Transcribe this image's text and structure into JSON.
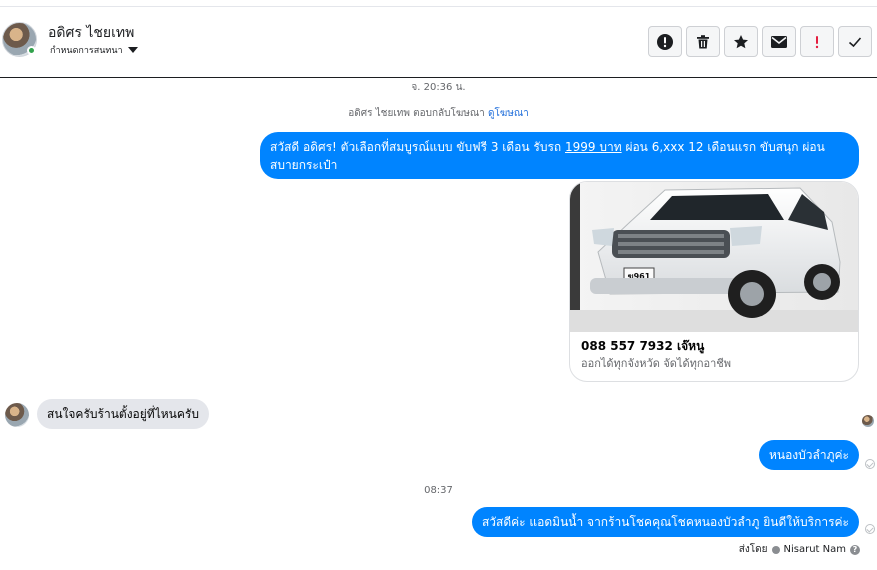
{
  "contact": {
    "name": "อดิศร ไชยเทพ",
    "assign_label": "กำหนดการสนทนา"
  },
  "toolbar": {
    "actions": [
      {
        "name": "spam-report-icon"
      },
      {
        "name": "trash-icon"
      },
      {
        "name": "star-icon"
      },
      {
        "name": "mail-icon"
      },
      {
        "name": "exclamation-icon"
      },
      {
        "name": "check-icon"
      }
    ]
  },
  "conversation": {
    "timestamp_1": "จ. 20:36 น.",
    "ad_reply_note": "อดิศร ไชยเทพ ตอบกลับโฆษณา",
    "ad_link": "ดูโฆษณา",
    "ad_message": {
      "part1": "สวัสดี อดิศร! ตัวเลือกที่สมบูรณ์แบบ ขับฟรี 3 เดือน รับรถ ",
      "link": "1999 บาท",
      "part2": " ผ่อน 6,xxx 12 เดือนแรก ขับสนุก ผ่อนสบายกระเป๋า"
    },
    "card": {
      "plate": "ฆ961",
      "title": "088 557 7932 เจ๊หนู",
      "subtitle": "ออกได้ทุกจังหวัด จัดได้ทุกอาชีพ"
    },
    "incoming_1": "สนใจครับร้านตั้งอยู่ที่ไหนครับ",
    "outgoing_1": "หนองบัวลำภูค่ะ",
    "timestamp_2": "08:37",
    "outgoing_2": "สวัสดีค่ะ แอดมินน้ำ จากร้านโชคคุณโชคหนองบัวลำภู ยินดีให้บริการค่ะ",
    "sent_by_label": "ส่งโดย",
    "sent_by_name": "Nisarut Nam",
    "help_glyph": "?"
  },
  "colors": {
    "outgoing_bubble": "#0084ff",
    "incoming_bubble": "#e4e6eb",
    "alert_red": "#e41e3f"
  }
}
